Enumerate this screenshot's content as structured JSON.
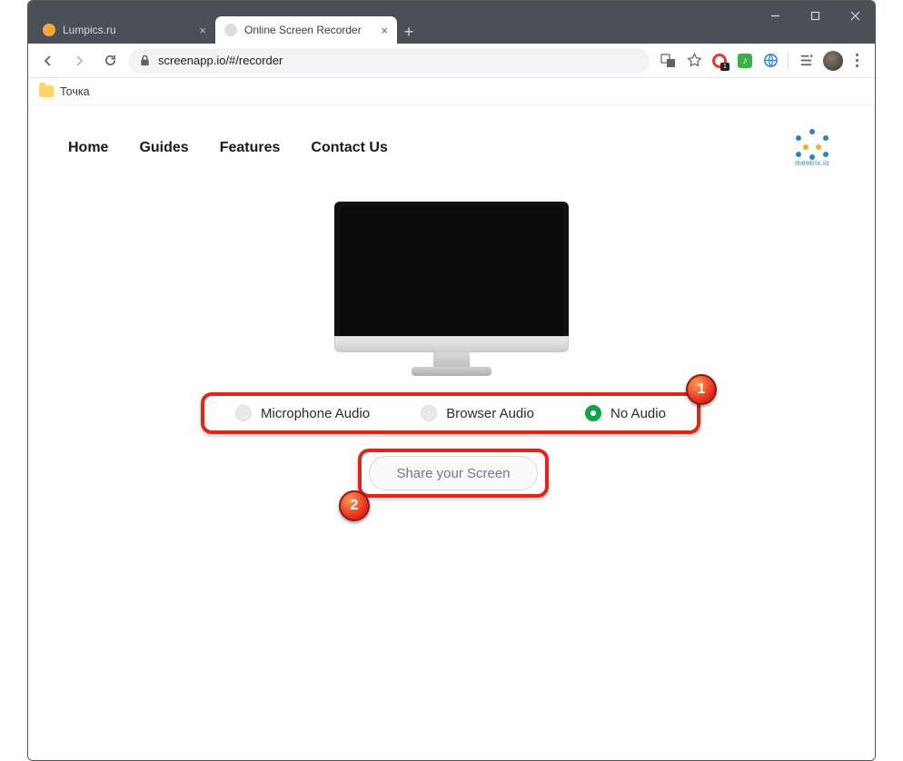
{
  "window": {
    "tabs": [
      {
        "title": "Lumpics.ru",
        "favicon_color": "#f4a93a",
        "active": false
      },
      {
        "title": "Online Screen Recorder",
        "favicon_color": "#dddddd",
        "active": true
      }
    ]
  },
  "browser": {
    "url": "screenapp.io/#/recorder",
    "bookmarks": [
      {
        "label": "Точка"
      }
    ]
  },
  "site": {
    "nav": [
      "Home",
      "Guides",
      "Features",
      "Contact Us"
    ],
    "logo_text": "meetrix.io"
  },
  "recorder": {
    "audio_options": [
      {
        "label": "Microphone Audio",
        "selected": false
      },
      {
        "label": "Browser Audio",
        "selected": false
      },
      {
        "label": "No Audio",
        "selected": true
      }
    ],
    "share_button": "Share your Screen"
  },
  "annotations": {
    "badge1": "1",
    "badge2": "2"
  }
}
